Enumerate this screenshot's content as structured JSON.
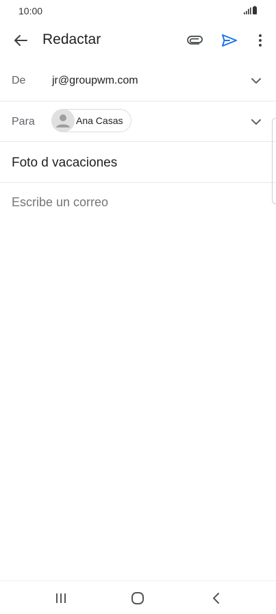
{
  "status_bar": {
    "time": "10:00",
    "icons": [
      "signal-icon",
      "battery-icon"
    ]
  },
  "toolbar": {
    "back_icon": "arrow-left-icon",
    "title": "Redactar",
    "attach_icon": "paperclip-icon",
    "send_icon": "send-icon",
    "more_icon": "more-vert-icon",
    "send_color": "#1a73e8"
  },
  "from": {
    "label": "De",
    "value": "jr@groupwm.com",
    "expand_icon": "chevron-down-icon"
  },
  "to": {
    "label": "Para",
    "recipient_name": "Ana Casas",
    "avatar_icon": "person-icon",
    "expand_icon": "chevron-down-icon"
  },
  "subject": {
    "value": "Foto d vacaciones"
  },
  "body": {
    "placeholder": "Escribe un correo"
  },
  "nav_bar": {
    "icons": [
      "recents-icon",
      "home-icon",
      "back-icon"
    ]
  }
}
